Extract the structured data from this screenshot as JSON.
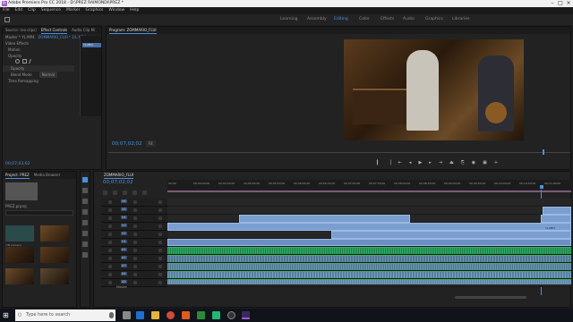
{
  "app": {
    "title": "Adobe Premiere Pro CC 2018 - D:\\PREZ RAIMONDI\\PREZ *"
  },
  "menu": [
    "File",
    "Edit",
    "Clip",
    "Sequence",
    "Marker",
    "Graphics",
    "Window",
    "Help"
  ],
  "workspaces": [
    "Learning",
    "Assembly",
    "Editing",
    "Color",
    "Effects",
    "Audio",
    "Graphics",
    "Libraries"
  ],
  "source_panel": {
    "tabs": [
      "Source: (no clips)",
      "Effect Controls",
      "Audio Clip Mi"
    ],
    "active_tab": "Effect Controls",
    "clip": "Master * YL.MP4",
    "seq": "ZOMMARIO_FLUI * 1/L.MP4",
    "sections": [
      "Video Effects",
      "Motion",
      "Opacity",
      "Time Remapping"
    ],
    "opacity_label": "Opacity",
    "blend_label": "Blend Mode",
    "blend_value": "Normal",
    "timecode": "00;07;03;02",
    "clip_badge": "YL.MP4"
  },
  "program": {
    "title": "Program: ZOMMARIO_FLUI",
    "timecode": "00;07;02;02",
    "zoom": "Fit"
  },
  "project": {
    "tabs": [
      "Project: PREZ",
      "Media Browser"
    ],
    "bin_label": "PREZ.prproj",
    "items": [
      "YIN Camera",
      "",
      "",
      "",
      "",
      ""
    ]
  },
  "timeline": {
    "tab": "ZOMMARIO_FLUI",
    "timecode": "00;07;02;02",
    "ruler": [
      "00;00",
      "00;04;00;00",
      "00;04;30;00",
      "00;05;00;00",
      "00;05;30;00",
      "00;06;00;00",
      "00;06;30;00",
      "00;07;00;00",
      "00;07;30;00",
      "00;08;00;00",
      "00;08;30;00",
      "00;09;00;00",
      "00;09;30;00",
      "00;10;00;00",
      "00;10;30;00",
      "00;11;00;00"
    ],
    "video_tracks": [
      "V6",
      "V5",
      "V4",
      "V3",
      "V2",
      "V1"
    ],
    "audio_tracks": [
      "A1",
      "A2",
      "A3",
      "A4",
      "A5"
    ],
    "clips": [
      {
        "label": "YL.MP4"
      },
      {
        "label": "YL.MP4"
      },
      {
        "label": "YL.MP4"
      },
      {
        "label": "YL.MP4"
      },
      {
        "label": "YL.MP4"
      },
      {
        "label": "YIN CAMPO"
      },
      {
        "label": "YL.MP4"
      }
    ],
    "master": "Master"
  },
  "taskbar": {
    "search_placeholder": "Type here to search"
  },
  "colors": {
    "accent": "#4a90e2",
    "clip": "#7a9ed0",
    "audio": "#2fae64"
  }
}
